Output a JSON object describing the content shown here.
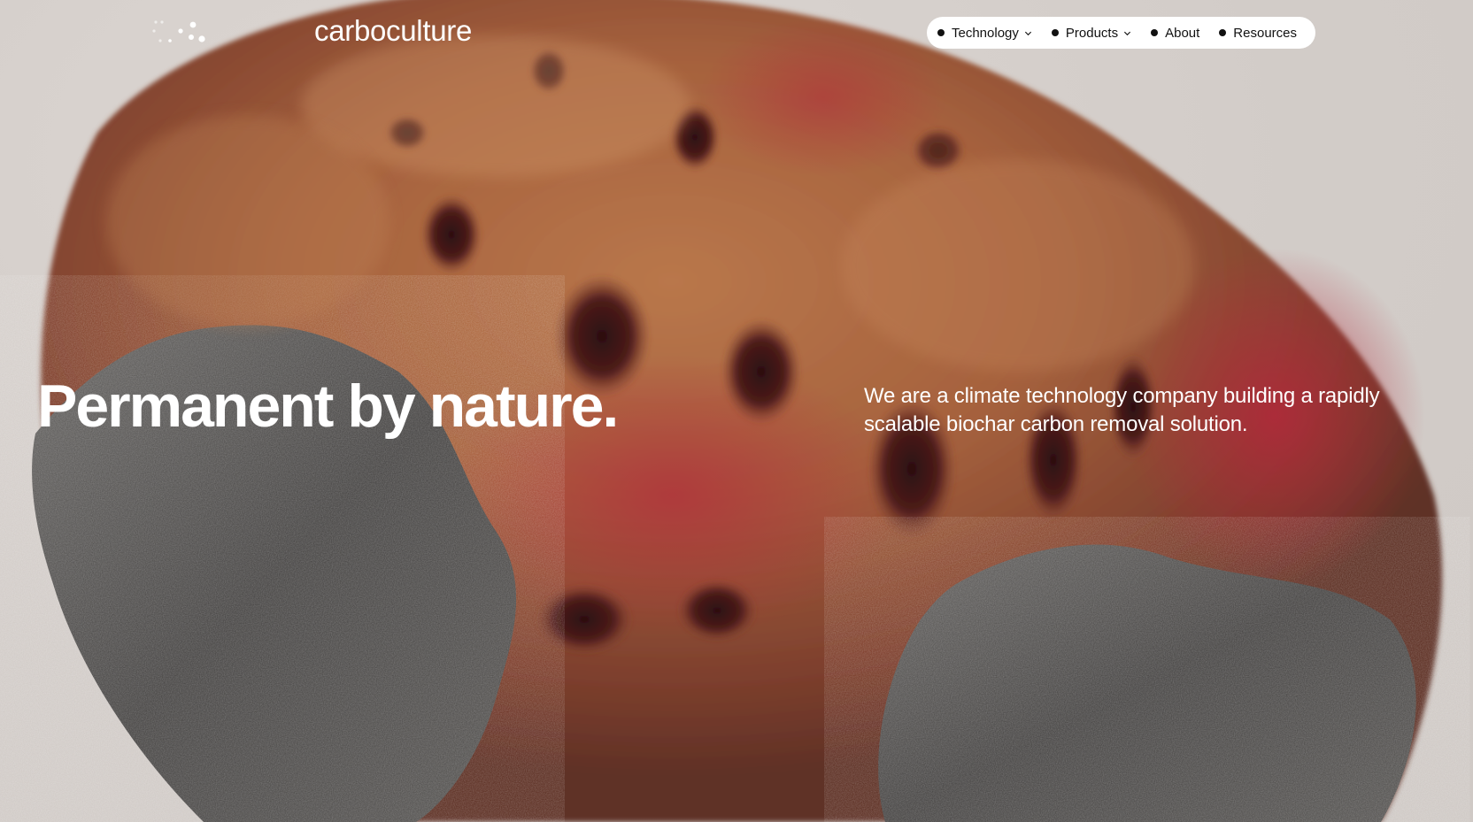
{
  "header": {
    "brand": "carboculture"
  },
  "nav": {
    "items": [
      {
        "label": "Technology",
        "has_dropdown": true
      },
      {
        "label": "Products",
        "has_dropdown": true
      },
      {
        "label": "About",
        "has_dropdown": false
      },
      {
        "label": "Resources",
        "has_dropdown": false
      }
    ]
  },
  "hero": {
    "headline": "Permanent by nature.",
    "tagline": "We are a climate technology company building a rapidly scalable biochar carbon removal solution."
  },
  "colors": {
    "background": "#d6d0cc",
    "text_on_image": "#ffffff",
    "nav_pill": "#ffffff",
    "nav_text": "#111111"
  },
  "icons": {
    "logo": "dots-logo-icon",
    "dropdown": "chevron-down-icon",
    "nav_bullet": "dot-icon"
  }
}
